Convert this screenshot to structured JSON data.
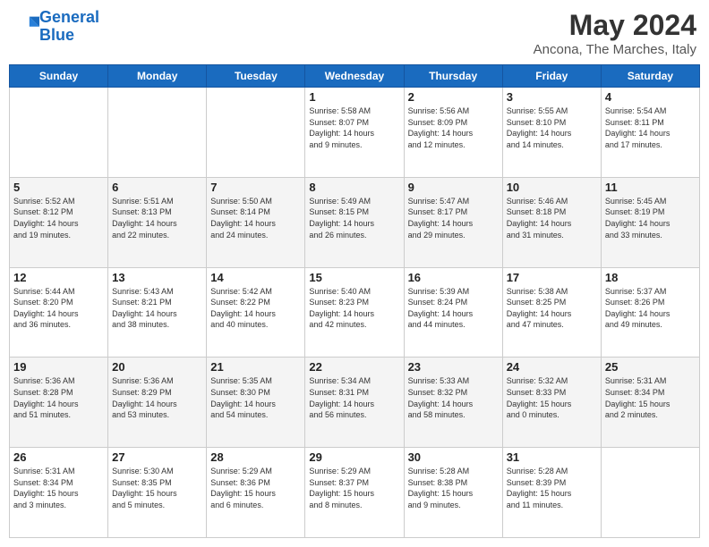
{
  "header": {
    "logo_line1": "General",
    "logo_line2": "Blue",
    "month": "May 2024",
    "location": "Ancona, The Marches, Italy"
  },
  "days_of_week": [
    "Sunday",
    "Monday",
    "Tuesday",
    "Wednesday",
    "Thursday",
    "Friday",
    "Saturday"
  ],
  "weeks": [
    [
      {
        "day": "",
        "info": ""
      },
      {
        "day": "",
        "info": ""
      },
      {
        "day": "",
        "info": ""
      },
      {
        "day": "1",
        "info": "Sunrise: 5:58 AM\nSunset: 8:07 PM\nDaylight: 14 hours\nand 9 minutes."
      },
      {
        "day": "2",
        "info": "Sunrise: 5:56 AM\nSunset: 8:09 PM\nDaylight: 14 hours\nand 12 minutes."
      },
      {
        "day": "3",
        "info": "Sunrise: 5:55 AM\nSunset: 8:10 PM\nDaylight: 14 hours\nand 14 minutes."
      },
      {
        "day": "4",
        "info": "Sunrise: 5:54 AM\nSunset: 8:11 PM\nDaylight: 14 hours\nand 17 minutes."
      }
    ],
    [
      {
        "day": "5",
        "info": "Sunrise: 5:52 AM\nSunset: 8:12 PM\nDaylight: 14 hours\nand 19 minutes."
      },
      {
        "day": "6",
        "info": "Sunrise: 5:51 AM\nSunset: 8:13 PM\nDaylight: 14 hours\nand 22 minutes."
      },
      {
        "day": "7",
        "info": "Sunrise: 5:50 AM\nSunset: 8:14 PM\nDaylight: 14 hours\nand 24 minutes."
      },
      {
        "day": "8",
        "info": "Sunrise: 5:49 AM\nSunset: 8:15 PM\nDaylight: 14 hours\nand 26 minutes."
      },
      {
        "day": "9",
        "info": "Sunrise: 5:47 AM\nSunset: 8:17 PM\nDaylight: 14 hours\nand 29 minutes."
      },
      {
        "day": "10",
        "info": "Sunrise: 5:46 AM\nSunset: 8:18 PM\nDaylight: 14 hours\nand 31 minutes."
      },
      {
        "day": "11",
        "info": "Sunrise: 5:45 AM\nSunset: 8:19 PM\nDaylight: 14 hours\nand 33 minutes."
      }
    ],
    [
      {
        "day": "12",
        "info": "Sunrise: 5:44 AM\nSunset: 8:20 PM\nDaylight: 14 hours\nand 36 minutes."
      },
      {
        "day": "13",
        "info": "Sunrise: 5:43 AM\nSunset: 8:21 PM\nDaylight: 14 hours\nand 38 minutes."
      },
      {
        "day": "14",
        "info": "Sunrise: 5:42 AM\nSunset: 8:22 PM\nDaylight: 14 hours\nand 40 minutes."
      },
      {
        "day": "15",
        "info": "Sunrise: 5:40 AM\nSunset: 8:23 PM\nDaylight: 14 hours\nand 42 minutes."
      },
      {
        "day": "16",
        "info": "Sunrise: 5:39 AM\nSunset: 8:24 PM\nDaylight: 14 hours\nand 44 minutes."
      },
      {
        "day": "17",
        "info": "Sunrise: 5:38 AM\nSunset: 8:25 PM\nDaylight: 14 hours\nand 47 minutes."
      },
      {
        "day": "18",
        "info": "Sunrise: 5:37 AM\nSunset: 8:26 PM\nDaylight: 14 hours\nand 49 minutes."
      }
    ],
    [
      {
        "day": "19",
        "info": "Sunrise: 5:36 AM\nSunset: 8:28 PM\nDaylight: 14 hours\nand 51 minutes."
      },
      {
        "day": "20",
        "info": "Sunrise: 5:36 AM\nSunset: 8:29 PM\nDaylight: 14 hours\nand 53 minutes."
      },
      {
        "day": "21",
        "info": "Sunrise: 5:35 AM\nSunset: 8:30 PM\nDaylight: 14 hours\nand 54 minutes."
      },
      {
        "day": "22",
        "info": "Sunrise: 5:34 AM\nSunset: 8:31 PM\nDaylight: 14 hours\nand 56 minutes."
      },
      {
        "day": "23",
        "info": "Sunrise: 5:33 AM\nSunset: 8:32 PM\nDaylight: 14 hours\nand 58 minutes."
      },
      {
        "day": "24",
        "info": "Sunrise: 5:32 AM\nSunset: 8:33 PM\nDaylight: 15 hours\nand 0 minutes."
      },
      {
        "day": "25",
        "info": "Sunrise: 5:31 AM\nSunset: 8:34 PM\nDaylight: 15 hours\nand 2 minutes."
      }
    ],
    [
      {
        "day": "26",
        "info": "Sunrise: 5:31 AM\nSunset: 8:34 PM\nDaylight: 15 hours\nand 3 minutes."
      },
      {
        "day": "27",
        "info": "Sunrise: 5:30 AM\nSunset: 8:35 PM\nDaylight: 15 hours\nand 5 minutes."
      },
      {
        "day": "28",
        "info": "Sunrise: 5:29 AM\nSunset: 8:36 PM\nDaylight: 15 hours\nand 6 minutes."
      },
      {
        "day": "29",
        "info": "Sunrise: 5:29 AM\nSunset: 8:37 PM\nDaylight: 15 hours\nand 8 minutes."
      },
      {
        "day": "30",
        "info": "Sunrise: 5:28 AM\nSunset: 8:38 PM\nDaylight: 15 hours\nand 9 minutes."
      },
      {
        "day": "31",
        "info": "Sunrise: 5:28 AM\nSunset: 8:39 PM\nDaylight: 15 hours\nand 11 minutes."
      },
      {
        "day": "",
        "info": ""
      }
    ]
  ]
}
